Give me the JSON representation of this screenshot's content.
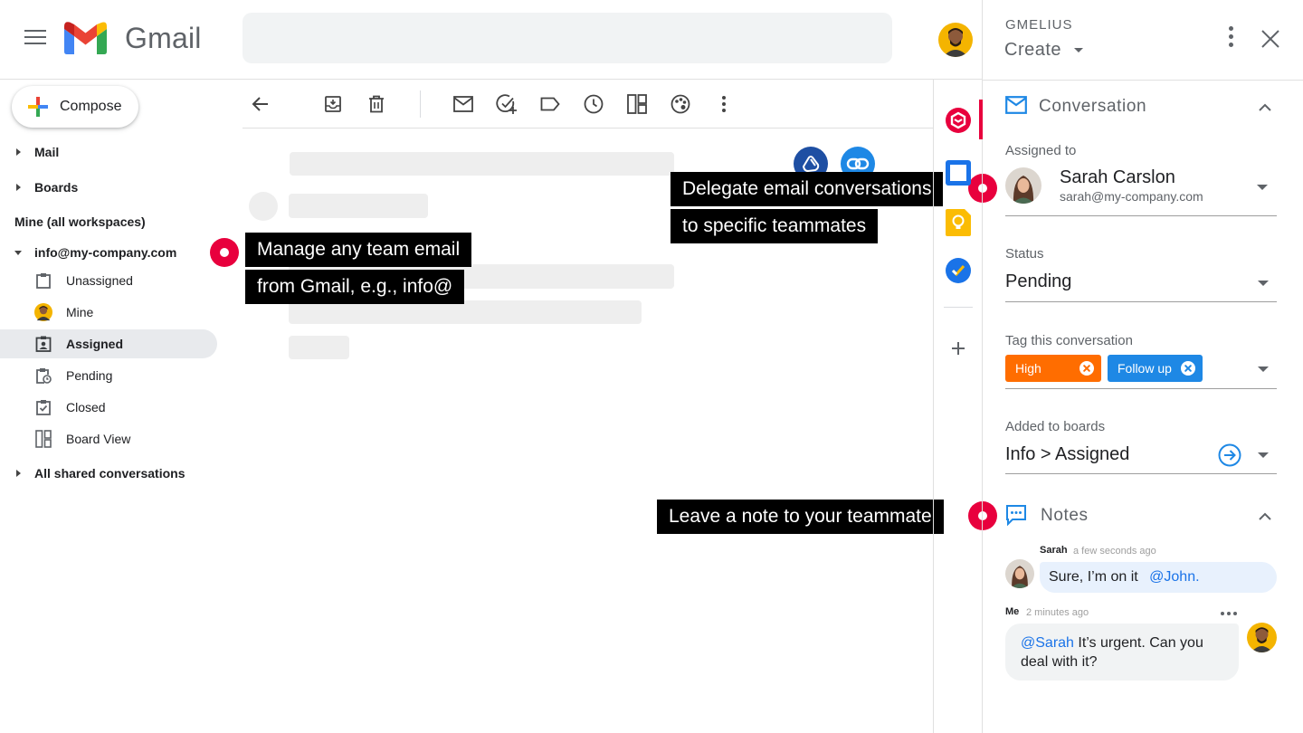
{
  "header": {
    "app_name": "Gmail"
  },
  "sidebar": {
    "compose_label": "Compose",
    "mail_label": "Mail",
    "boards_label": "Boards",
    "mine_all_label": "Mine (all workspaces)",
    "account_label": "info@my-company.com",
    "items": [
      {
        "label": "Unassigned",
        "icon": "clipboard-icon"
      },
      {
        "label": "Mine",
        "icon": "avatar"
      },
      {
        "label": "Assigned",
        "icon": "assigned-icon",
        "active": true
      },
      {
        "label": "Pending",
        "icon": "clipboard-clock-icon"
      },
      {
        "label": "Closed",
        "icon": "clipboard-check-icon"
      },
      {
        "label": "Board View",
        "icon": "board-icon"
      }
    ],
    "shared_label": "All shared conversations"
  },
  "callouts": {
    "manage_line1": "Manage any team email",
    "manage_line2": "from Gmail, e.g., info@",
    "delegate_line1": "Delegate email conversations",
    "delegate_line2": "to specific teammates",
    "note": "Leave a note to your teammate"
  },
  "panel": {
    "brand": "GMELIUS",
    "create_label": "Create",
    "conversation": {
      "title": "Conversation",
      "assigned_label": "Assigned to",
      "assignee_name": "Sarah Carslon",
      "assignee_email": "sarah@my-company.com",
      "status_label": "Status",
      "status_value": "Pending",
      "tag_label": "Tag this conversation",
      "tags": [
        {
          "label": "High",
          "color": "#ff6d00"
        },
        {
          "label": "Follow up",
          "color": "#1e88e5"
        }
      ],
      "boards_label": "Added to boards",
      "boards_value": "Info > Assigned"
    },
    "notes": {
      "title": "Notes",
      "items": [
        {
          "author": "Sarah",
          "time": "a few seconds ago",
          "text": "Sure, I’m on it",
          "mention": "@John."
        },
        {
          "author": "Me",
          "time": "2 minutes ago",
          "mention": "@Sarah",
          "text_line1": " It’s urgent. Can you",
          "text_line2": "deal with it?"
        }
      ]
    }
  },
  "colors": {
    "accent_red": "#e8003d",
    "gmail_blue": "#1a73e8",
    "tag_orange": "#ff6d00",
    "tag_blue": "#1e88e5"
  }
}
